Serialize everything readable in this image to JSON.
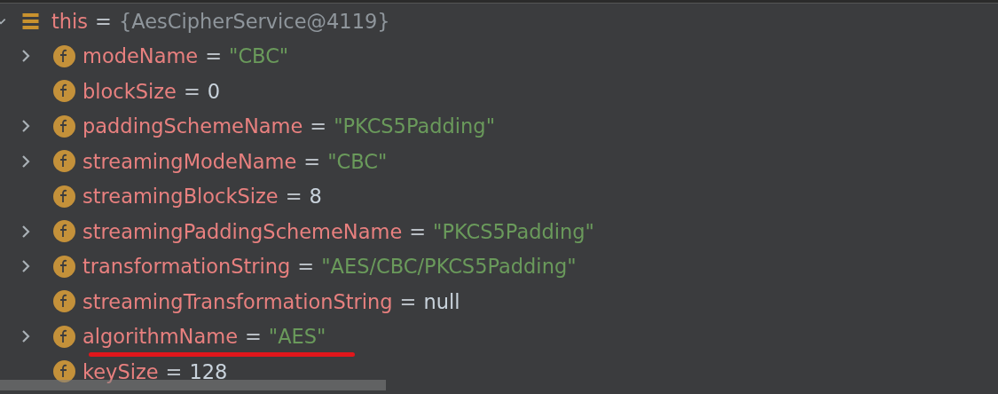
{
  "root": {
    "expanded": true,
    "name": "this",
    "value": "{AesCipherService@4119}",
    "children": [
      {
        "expandable": true,
        "name": "modeName",
        "value": "\"CBC\"",
        "kind": "string",
        "underlined": false
      },
      {
        "expandable": false,
        "name": "blockSize",
        "value": "0",
        "kind": "number",
        "underlined": false
      },
      {
        "expandable": true,
        "name": "paddingSchemeName",
        "value": "\"PKCS5Padding\"",
        "kind": "string",
        "underlined": false
      },
      {
        "expandable": true,
        "name": "streamingModeName",
        "value": "\"CBC\"",
        "kind": "string",
        "underlined": false
      },
      {
        "expandable": false,
        "name": "streamingBlockSize",
        "value": "8",
        "kind": "number",
        "underlined": false
      },
      {
        "expandable": true,
        "name": "streamingPaddingSchemeName",
        "value": "\"PKCS5Padding\"",
        "kind": "string",
        "underlined": false
      },
      {
        "expandable": true,
        "name": "transformationString",
        "value": "\"AES/CBC/PKCS5Padding\"",
        "kind": "string",
        "underlined": false
      },
      {
        "expandable": false,
        "name": "streamingTransformationString",
        "value": "null",
        "kind": "number",
        "underlined": false
      },
      {
        "expandable": true,
        "name": "algorithmName",
        "value": "\"AES\"",
        "kind": "string",
        "underlined": true
      },
      {
        "expandable": false,
        "name": "keySize",
        "value": "128",
        "kind": "number",
        "underlined": false
      }
    ]
  },
  "eq": "="
}
